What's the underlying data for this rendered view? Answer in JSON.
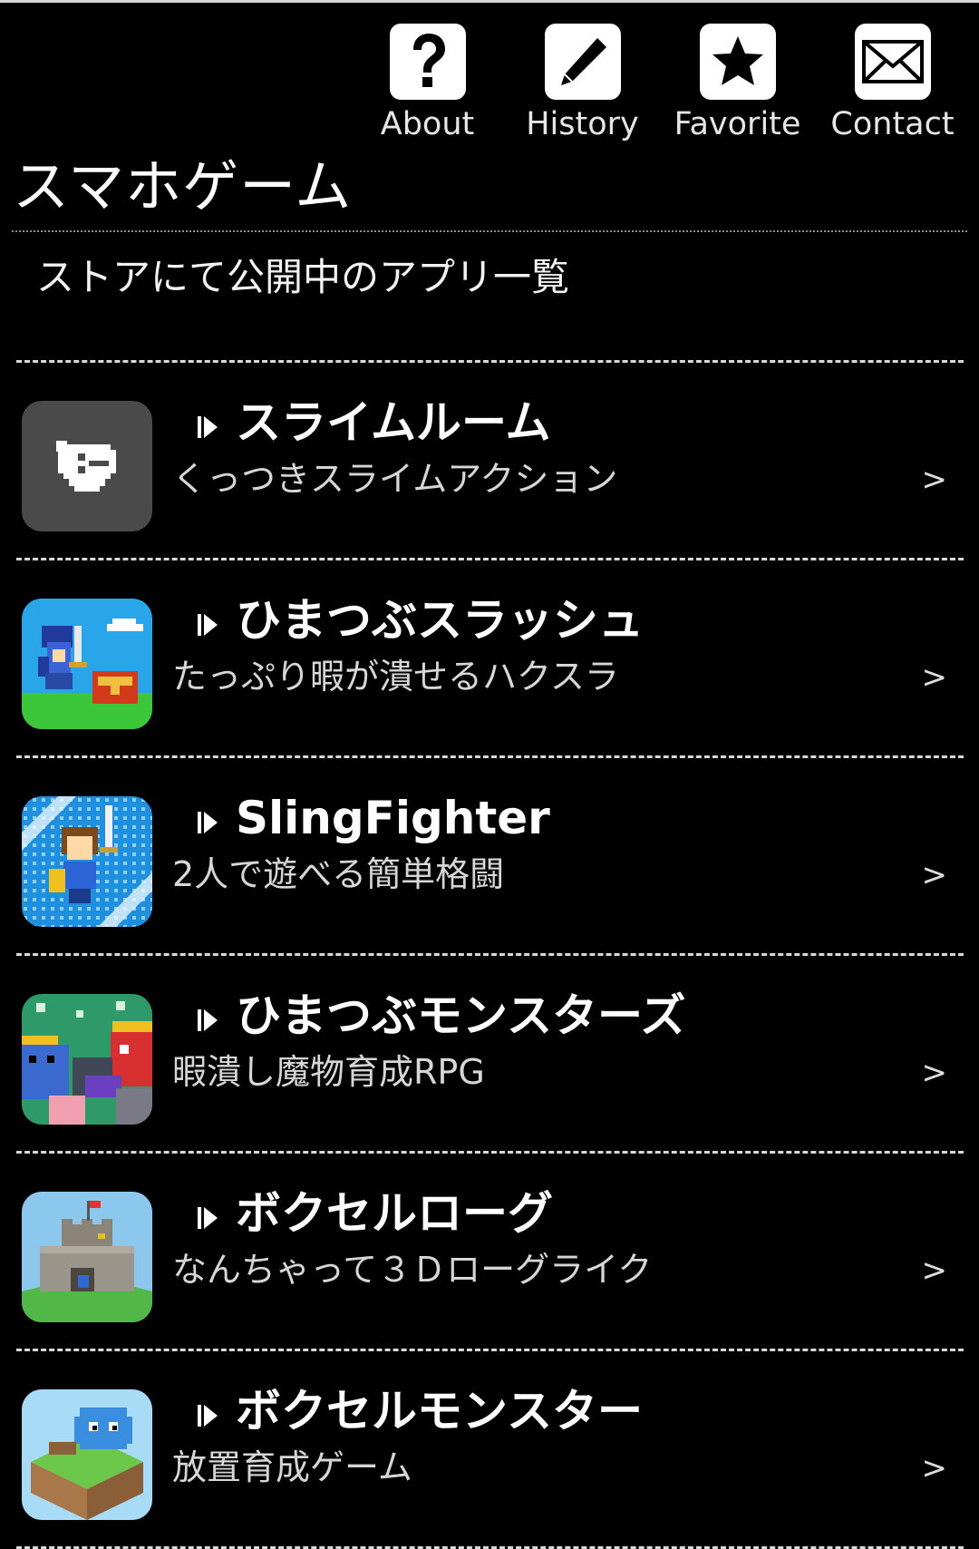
{
  "nav": {
    "items": [
      {
        "label": "About",
        "icon": "question-icon"
      },
      {
        "label": "History",
        "icon": "pencil-icon"
      },
      {
        "label": "Favorite",
        "icon": "star-icon"
      },
      {
        "label": "Contact",
        "icon": "envelope-icon"
      }
    ]
  },
  "page": {
    "title": "スマホゲーム",
    "subtitle": "ストアにて公開中のアプリ一覧"
  },
  "apps": [
    {
      "name": "スライムルーム",
      "desc": "くっつきスライムアクション",
      "chevron": ">"
    },
    {
      "name": "ひまつぶスラッシュ",
      "desc": "たっぷり暇が潰せるハクスラ",
      "chevron": ">"
    },
    {
      "name": "SlingFighter",
      "desc": "2人で遊べる簡単格闘",
      "chevron": ">"
    },
    {
      "name": "ひまつぶモンスターズ",
      "desc": "暇潰し魔物育成RPG",
      "chevron": ">"
    },
    {
      "name": "ボクセルローグ",
      "desc": "なんちゃって３Ｄローグライク",
      "chevron": ">"
    },
    {
      "name": "ボクセルモンスター",
      "desc": "放置育成ゲーム",
      "chevron": ">"
    }
  ],
  "colors": {
    "background": "#000000",
    "text": "#ffffff",
    "divider": "#d8d8d8"
  }
}
